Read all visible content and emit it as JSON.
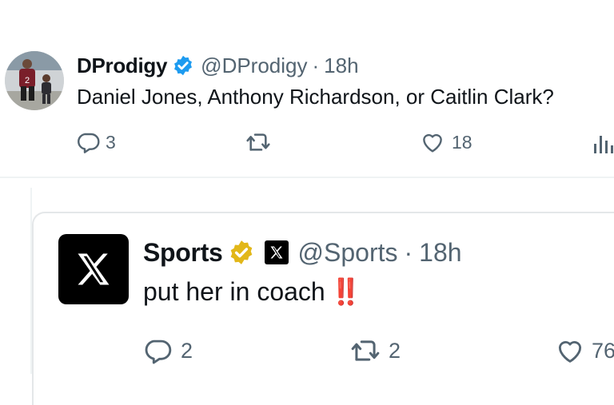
{
  "tweet": {
    "author_name": "DProdigy",
    "handle": "@DProdigy",
    "separator": "·",
    "time": "18h",
    "text": "Daniel Jones, Anthony Richardson, or Caitlin Clark?",
    "replies": "3",
    "reposts": "",
    "likes": "18",
    "verified_badge": "blue-check-icon",
    "icons": [
      "reply-icon",
      "repost-icon",
      "like-icon",
      "views-icon"
    ]
  },
  "reply": {
    "author_name": "Sports",
    "handle": "@Sports",
    "separator": "·",
    "time": "18h",
    "text": "put her in coach",
    "emoji": "‼️",
    "replies": "2",
    "reposts": "2",
    "likes": "76",
    "verified_badge": "gold-check-icon",
    "affiliate_badge": "x-logo-icon"
  },
  "colors": {
    "text": "#0f1419",
    "secondary": "#536471",
    "verified_blue": "#1d9bf0",
    "verified_gold": "#e2b719",
    "emoji_red": "#e0002b",
    "divider": "#eff3f4"
  }
}
